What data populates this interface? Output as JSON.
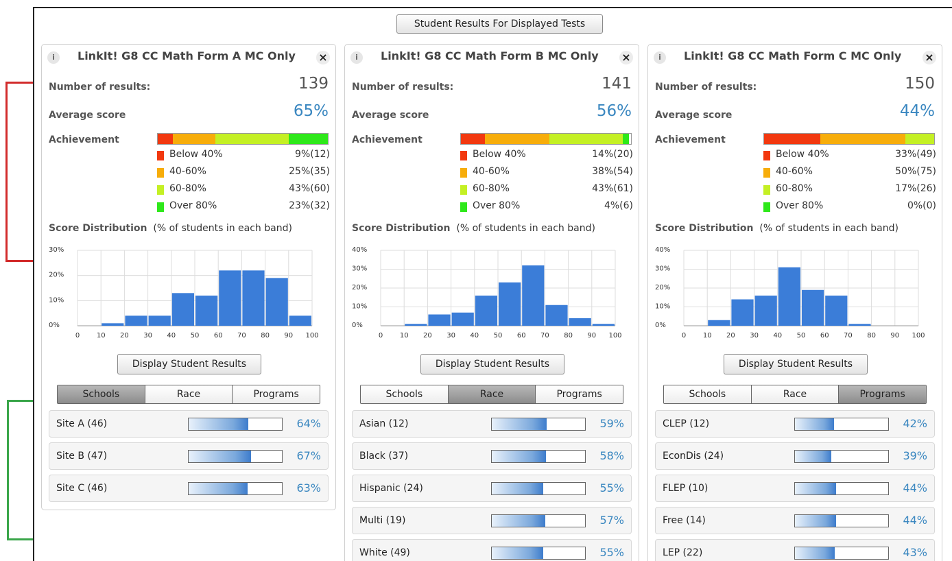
{
  "top_button": "Student Results For Displayed Tests",
  "labels": {
    "results": "Number of results:",
    "average": "Average score",
    "achievement": "Achievement",
    "distribution_bold": "Score Distribution",
    "distribution_note": "(% of students in each band)",
    "display_button": "Display Student Results"
  },
  "tabs": [
    "Schools",
    "Race",
    "Programs"
  ],
  "band_labels": [
    "Below 40%",
    "40-60%",
    "60-80%",
    "Over 80%"
  ],
  "band_colors": [
    "#f2380f",
    "#f7ad0a",
    "#c4f024",
    "#2ee81a"
  ],
  "panels": [
    {
      "title": "LinkIt! G8 CC Math Form A MC Only",
      "results": "139",
      "average": "65%",
      "achievement": [
        9,
        25,
        43,
        23
      ],
      "bands": [
        "9%(12)",
        "25%(35)",
        "43%(60)",
        "23%(32)"
      ],
      "active_tab": 0,
      "chart_data": {
        "type": "bar",
        "x_range": [
          0,
          100
        ],
        "x_ticks": [
          "0",
          "10",
          "20",
          "30",
          "40",
          "50",
          "60",
          "70",
          "80",
          "90",
          "100"
        ],
        "y_max": 30,
        "y_ticks": [
          "0%",
          "10%",
          "20%",
          "30%"
        ],
        "bins": [
          10,
          20,
          30,
          40,
          50,
          60,
          70,
          80,
          90
        ],
        "values": [
          1,
          4,
          4,
          13,
          12,
          22,
          22,
          19,
          4
        ],
        "grid": true,
        "color": "#3b7dd8"
      },
      "groups": [
        {
          "label": "Site A (46)",
          "pct": "64%",
          "value": 64
        },
        {
          "label": "Site B (47)",
          "pct": "67%",
          "value": 67
        },
        {
          "label": "Site C (46)",
          "pct": "63%",
          "value": 63
        }
      ]
    },
    {
      "title": "LinkIt! G8 CC Math Form B MC Only",
      "results": "141",
      "average": "56%",
      "achievement": [
        14,
        38,
        43,
        4
      ],
      "bands": [
        "14%(20)",
        "38%(54)",
        "43%(61)",
        "4%(6)"
      ],
      "active_tab": 1,
      "chart_data": {
        "type": "bar",
        "x_range": [
          0,
          100
        ],
        "x_ticks": [
          "0",
          "10",
          "20",
          "30",
          "40",
          "50",
          "60",
          "70",
          "80",
          "90",
          "100"
        ],
        "y_max": 40,
        "y_ticks": [
          "0%",
          "10%",
          "20%",
          "30%",
          "40%"
        ],
        "bins": [
          10,
          20,
          30,
          40,
          50,
          60,
          70,
          80,
          90
        ],
        "values": [
          1,
          6,
          7,
          16,
          23,
          32,
          11,
          4,
          1
        ],
        "grid": true,
        "color": "#3b7dd8"
      },
      "groups": [
        {
          "label": "Asian (12)",
          "pct": "59%",
          "value": 59
        },
        {
          "label": "Black (37)",
          "pct": "58%",
          "value": 58
        },
        {
          "label": "Hispanic (24)",
          "pct": "55%",
          "value": 55
        },
        {
          "label": "Multi (19)",
          "pct": "57%",
          "value": 57
        },
        {
          "label": "White (49)",
          "pct": "55%",
          "value": 55
        }
      ]
    },
    {
      "title": "LinkIt! G8 CC Math Form C MC Only",
      "results": "150",
      "average": "44%",
      "achievement": [
        33,
        50,
        17,
        0
      ],
      "bands": [
        "33%(49)",
        "50%(75)",
        "17%(26)",
        "0%(0)"
      ],
      "active_tab": 2,
      "chart_data": {
        "type": "bar",
        "x_range": [
          0,
          100
        ],
        "x_ticks": [
          "0",
          "10",
          "20",
          "30",
          "40",
          "50",
          "60",
          "70",
          "80",
          "90",
          "100"
        ],
        "y_max": 40,
        "y_ticks": [
          "0%",
          "10%",
          "20%",
          "30%",
          "40%"
        ],
        "bins": [
          10,
          20,
          30,
          40,
          50,
          60,
          70,
          80,
          90
        ],
        "values": [
          3,
          14,
          16,
          31,
          19,
          16,
          1,
          0,
          0
        ],
        "grid": true,
        "color": "#3b7dd8"
      },
      "groups": [
        {
          "label": "CLEP (12)",
          "pct": "42%",
          "value": 42
        },
        {
          "label": "EconDis (24)",
          "pct": "39%",
          "value": 39
        },
        {
          "label": "FLEP (10)",
          "pct": "44%",
          "value": 44
        },
        {
          "label": "Free (14)",
          "pct": "44%",
          "value": 44
        },
        {
          "label": "LEP (22)",
          "pct": "43%",
          "value": 43
        }
      ]
    }
  ]
}
